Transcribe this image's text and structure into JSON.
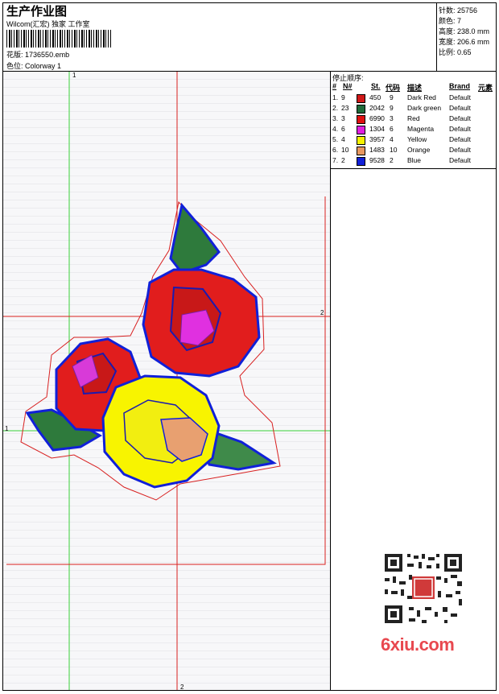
{
  "header": {
    "title": "生产作业图",
    "company": "Wilcom(汇宏) 独家 工作室",
    "design_label": "花版:",
    "design_value": "1736550.emb",
    "colorway_label": "色位:",
    "colorway_value": "Colorway 1"
  },
  "stats": {
    "stitches": "针数: 25756",
    "colors": "颜色: 7",
    "height": "高度: 238.0 mm",
    "width": "宽度: 206.6 mm",
    "scale": "比例: 0.65"
  },
  "stop_panel": {
    "title": "停止顺序:",
    "headers": {
      "num": "#",
      "n": "N#",
      "st": "St.",
      "code": "代码",
      "desc": "描述",
      "brand": "Brand",
      "element": "元素"
    },
    "rows": [
      {
        "idx": "1.",
        "n": "9",
        "st": "450",
        "code": "9",
        "desc": "Dark Red",
        "brand": "Default",
        "color": "#d01818"
      },
      {
        "idx": "2.",
        "n": "23",
        "st": "2042",
        "code": "9",
        "desc": "Dark green",
        "brand": "Default",
        "color": "#1f6b3a"
      },
      {
        "idx": "3.",
        "n": "3",
        "st": "6990",
        "code": "3",
        "desc": "Red",
        "brand": "Default",
        "color": "#e01010"
      },
      {
        "idx": "4.",
        "n": "6",
        "st": "1304",
        "code": "6",
        "desc": "Magenta",
        "brand": "Default",
        "color": "#e020e0"
      },
      {
        "idx": "5.",
        "n": "4",
        "st": "3957",
        "code": "4",
        "desc": "Yellow",
        "brand": "Default",
        "color": "#f6f200"
      },
      {
        "idx": "6.",
        "n": "10",
        "st": "1483",
        "code": "10",
        "desc": "Orange",
        "brand": "Default",
        "color": "#e89860"
      },
      {
        "idx": "7.",
        "n": "2",
        "st": "9528",
        "code": "2",
        "desc": "Blue",
        "brand": "Default",
        "color": "#1020d8"
      }
    ]
  },
  "canvas": {
    "guide_label_1": "1",
    "guide_label_2": "2"
  },
  "watermark": {
    "site": "6xiu.com"
  }
}
